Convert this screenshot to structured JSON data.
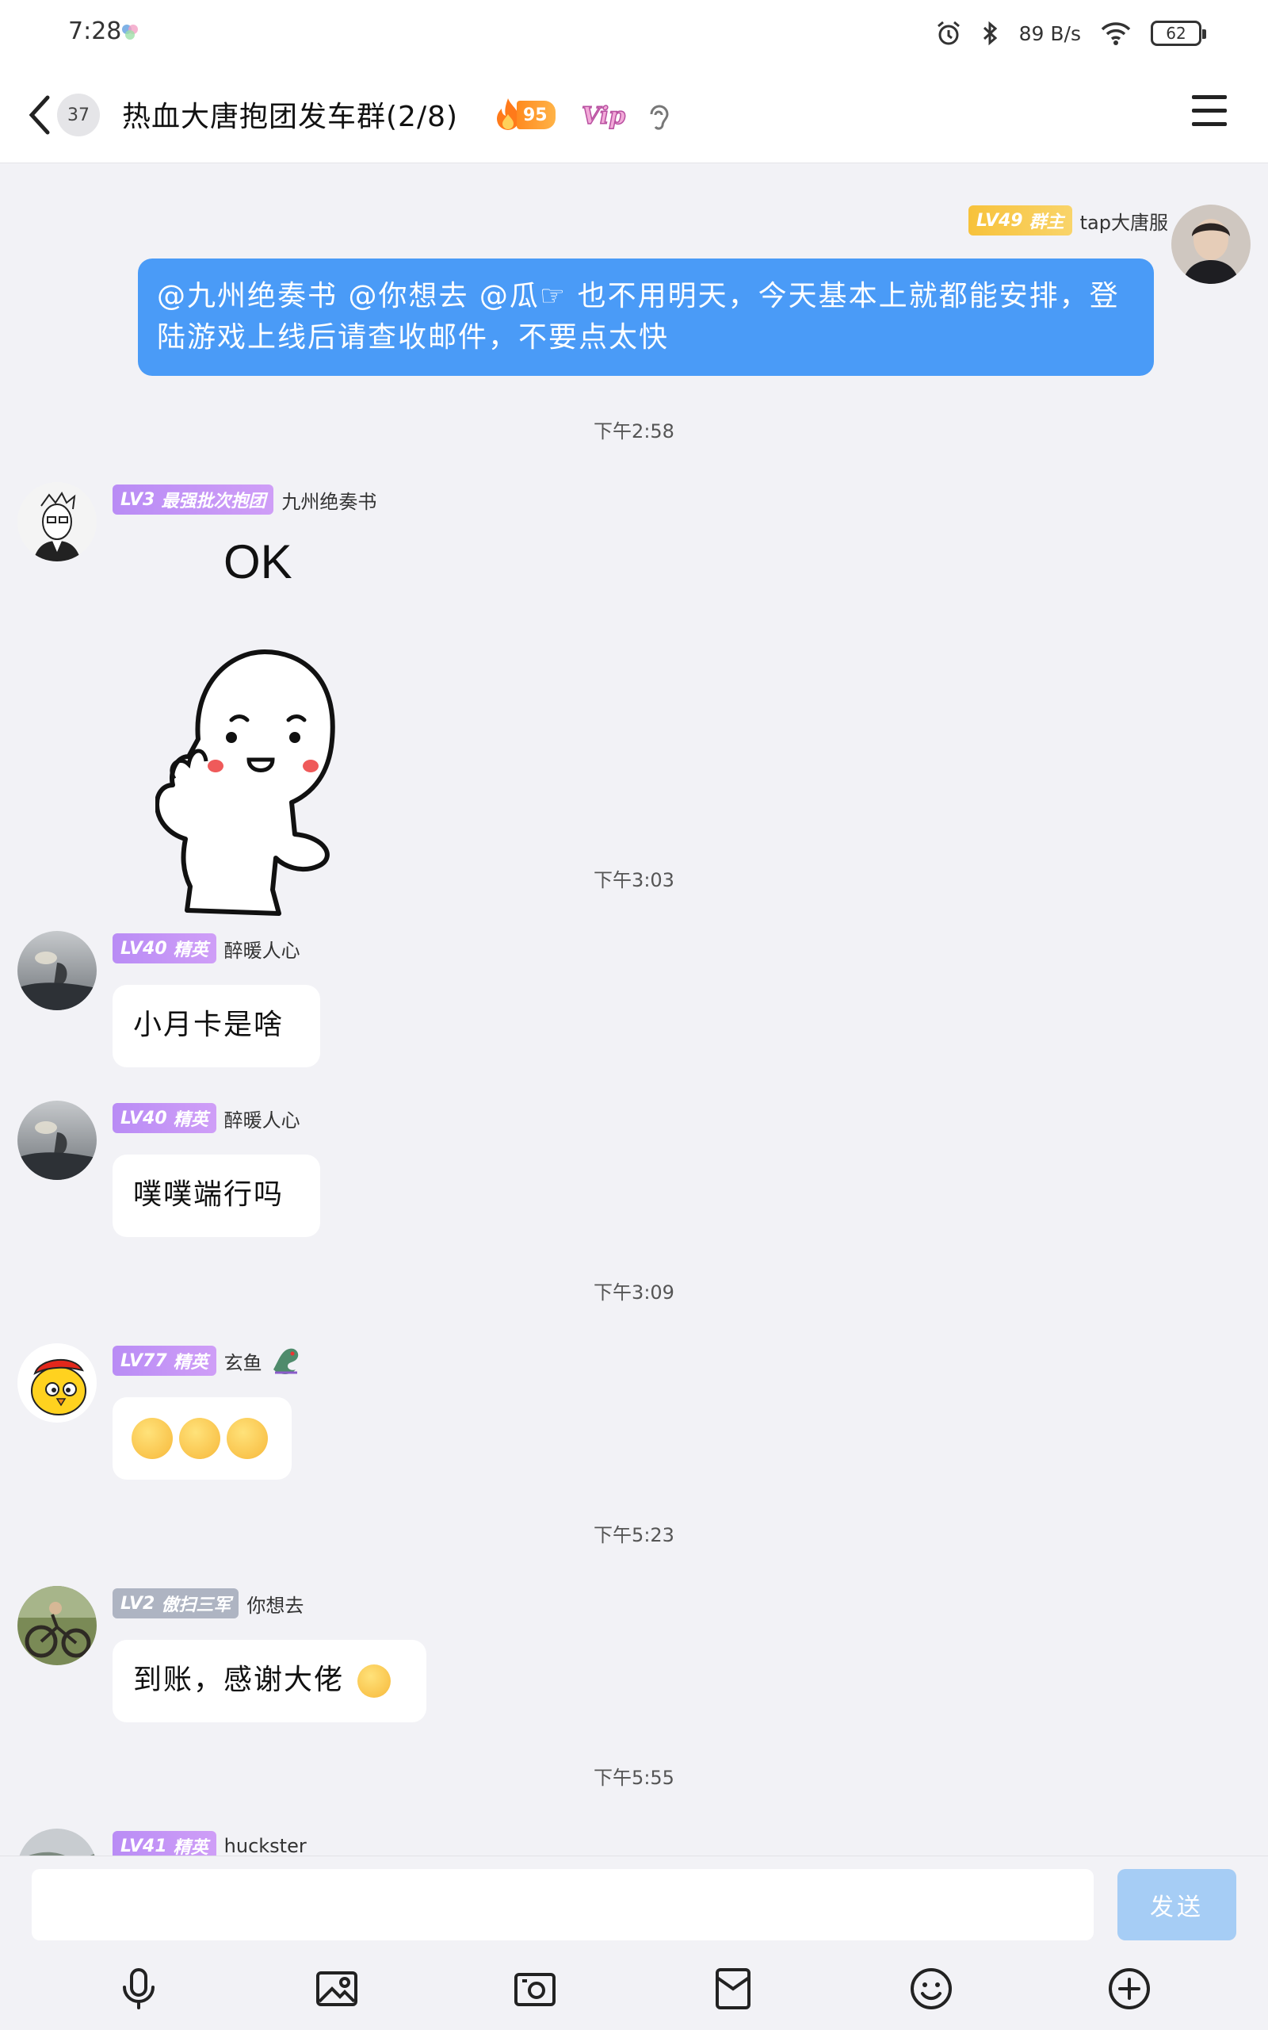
{
  "status_bar": {
    "time": "7:28",
    "network_speed": "89 B/s",
    "battery": "62"
  },
  "nav": {
    "unread_count": "37",
    "title": "热血大唐抱团发车群(2/8)",
    "fire_level": "95",
    "vip_label": "Vip"
  },
  "messages": {
    "m1": {
      "level": "LV49",
      "role": "群主",
      "name": "tap大唐服",
      "text": "@九州绝奏书 @你想去 @瓜☞ 也不用明天，今天基本上就都能安排，登陆游戏上线后请查收邮件，不要点太快"
    },
    "t1": "下午2:58",
    "m2": {
      "level": "LV3",
      "role": "最强批次抱团",
      "name": "九州绝奏书",
      "sticker_text": "OK"
    },
    "t2": "下午3:03",
    "m3": {
      "level": "LV40",
      "role": "精英",
      "name": "醉暖人心",
      "text": "小月卡是啥"
    },
    "m4": {
      "level": "LV40",
      "role": "精英",
      "name": "醉暖人心",
      "text": "噗噗端行吗"
    },
    "t3": "下午3:09",
    "m5": {
      "level": "LV77",
      "role": "精英",
      "name": "玄鱼"
    },
    "t4": "下午5:23",
    "m6": {
      "level": "LV2",
      "role": "傲扫三军",
      "name": "你想去",
      "text": "到账，感谢大佬"
    },
    "t5": "下午5:55",
    "m7": {
      "level": "LV41",
      "role": "精英",
      "name": "huckster"
    }
  },
  "input": {
    "placeholder": "",
    "send_label": "发送"
  },
  "toolbar": {
    "icons": [
      "microphone-icon",
      "image-icon",
      "camera-icon",
      "red-packet-icon",
      "emoji-icon",
      "plus-icon"
    ]
  },
  "colors": {
    "accent_blue": "#4a9bf7",
    "send_disabled": "#a6cdf5",
    "tag_purple": "#c394f6",
    "tag_gold": "#f8c84a",
    "tag_grey": "#aeb4c2",
    "background": "#f2f2f6"
  }
}
